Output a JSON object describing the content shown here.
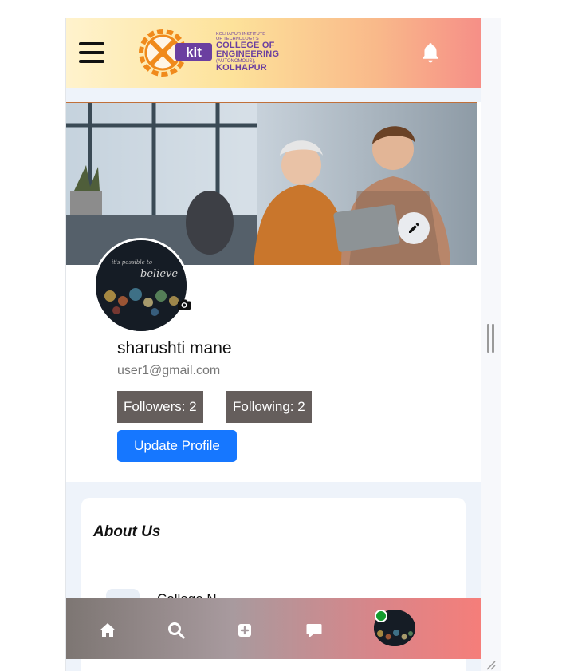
{
  "header": {
    "logo": {
      "line1": "KOLHAPUR INSTITUTE",
      "line2": "OF TECHNOLOGY'S",
      "line3": "COLLEGE OF",
      "line4": "ENGINEERING",
      "line5": "(AUTONOMOUS),",
      "line6": "KOLHAPUR",
      "mark": "kit"
    },
    "menu_icon": "hamburger-icon",
    "notification_icon": "bell-icon"
  },
  "profile": {
    "name": "sharushti mane",
    "email": "user1@gmail.com",
    "followers_label": "Followers: 2",
    "following_label": "Following: 2",
    "update_button": "Update Profile",
    "avatar_caption": "believe"
  },
  "about": {
    "title": "About Us",
    "row_label": "College N..."
  },
  "bottom_nav": {
    "items": [
      "home-icon",
      "search-icon",
      "add-post-icon",
      "messages-icon",
      "profile-avatar"
    ]
  },
  "colors": {
    "primary_button": "#1677ff",
    "badge_bg": "#655e5c",
    "online": "#149c2e",
    "header_gradient_start": "#fff3cd",
    "header_gradient_end": "#f68f87"
  }
}
